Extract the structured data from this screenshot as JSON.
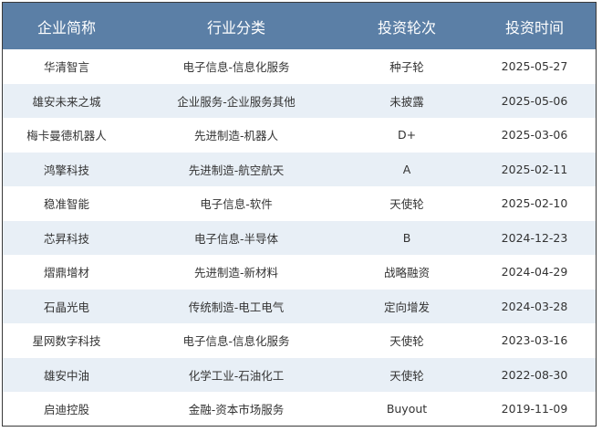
{
  "table": {
    "headers": [
      "企业简称",
      "行业分类",
      "投资轮次",
      "投资时间"
    ],
    "rows": [
      [
        "华清智言",
        "电子信息-信息化服务",
        "种子轮",
        "2025-05-27"
      ],
      [
        "雄安未来之城",
        "企业服务-企业服务其他",
        "未披露",
        "2025-05-06"
      ],
      [
        "梅卡曼德机器人",
        "先进制造-机器人",
        "D+",
        "2025-03-06"
      ],
      [
        "鸿擎科技",
        "先进制造-航空航天",
        "A",
        "2025-02-11"
      ],
      [
        "稳准智能",
        "电子信息-软件",
        "天使轮",
        "2025-02-10"
      ],
      [
        "芯昇科技",
        "电子信息-半导体",
        "B",
        "2024-12-23"
      ],
      [
        "熠鼎增材",
        "先进制造-新材料",
        "战略融资",
        "2024-04-29"
      ],
      [
        "石晶光电",
        "传统制造-电工电气",
        "定向增发",
        "2024-03-28"
      ],
      [
        "星网数字科技",
        "电子信息-信息化服务",
        "天使轮",
        "2023-03-16"
      ],
      [
        "雄安中油",
        "化学工业-石油化工",
        "天使轮",
        "2022-08-30"
      ],
      [
        "启迪控股",
        "金融-资本市场服务",
        "Buyout",
        "2019-11-09"
      ]
    ]
  },
  "colors": {
    "header_bg": "#5b7fa6",
    "row_alt_bg": "#e8eff6",
    "border": "#3a3a3a"
  }
}
